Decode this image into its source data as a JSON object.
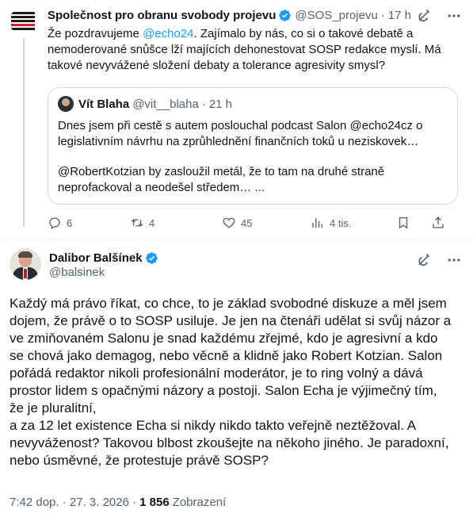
{
  "parent_tweet": {
    "author_name": "Společnost pro obranu svobody projevu",
    "handle": "@SOS_projevu",
    "separator": "·",
    "time": "17 h",
    "text_lines": [
      [
        "Že pozdravujeme ",
        "@echo24",
        ". Zajímalo by nás, co si o takové debatě a"
      ],
      [
        "nemoderované snůšce lží majících dehonestovat SOSP redakce myslí. Má"
      ],
      [
        "takové nevyvážené složení debaty a tolerance agresivity smysl?"
      ]
    ],
    "quote": {
      "author_name": "Vít Blaha",
      "handle": "@vit__blaha",
      "separator": "·",
      "time": "21 h",
      "text_lines": [
        "Dnes jsem při cestě s autem poslouchal podcast Salon @echo24cz  o",
        "legislativním návrhu na zprůhlednění finančních toků u neziskovek…",
        "",
        "@RobertKotzian by zasloužil metál, že to tam na druhé straně",
        "neprofackoval a neodešel středem… ..."
      ]
    },
    "actions": {
      "replies": "6",
      "reposts": "4",
      "likes": "45",
      "views": "4 tis."
    }
  },
  "main_tweet": {
    "author_name": "Dalibor Balšínek",
    "handle": "@balsinek",
    "text_lines": [
      "Každý má právo říkat, co chce, to je základ svobodné diskuze a měl jsem",
      "dojem, že právě o to SOSP usiluje. Je jen na čtenáři udělat si svůj názor a",
      "ve zmiňovaném Salonu je snad každému zřejmé, kdo je agresivní a kdo",
      "se chová jako demagog, nebo věcně a klidně jako Robert Kotzian. Salon",
      "pořádá redaktor nikoli profesionální  moderátor, je to ring volný a dává",
      "prostor lidem s opačnými názory a postoji. Salon Echa je výjimečný tím,",
      "že je pluralitní,",
      "a za 12 let existence Echa si nikdy nikdo takto veřejně neztěžoval. A",
      "nevyváženost? Takovou blbost zkoušejte na někoho jiného. Je paradoxní,",
      "nebo úsměvné, že protestuje právě SOSP?"
    ],
    "timestamp": "7:42 dop. · 27. 3. 2026 ·",
    "views_count": "1 856",
    "views_label": "Zobrazení"
  },
  "icons": {
    "verified": "verified-badge-icon",
    "grok": "grok-icon",
    "more": "more-icon",
    "reply": "reply-icon",
    "repost": "repost-icon",
    "like": "heart-icon",
    "views": "views-icon",
    "bookmark": "bookmark-icon",
    "share": "share-icon"
  },
  "colors": {
    "accent": "#1d9bf0",
    "text": "#0f1419",
    "muted": "#536471",
    "border": "#cfd9de"
  }
}
